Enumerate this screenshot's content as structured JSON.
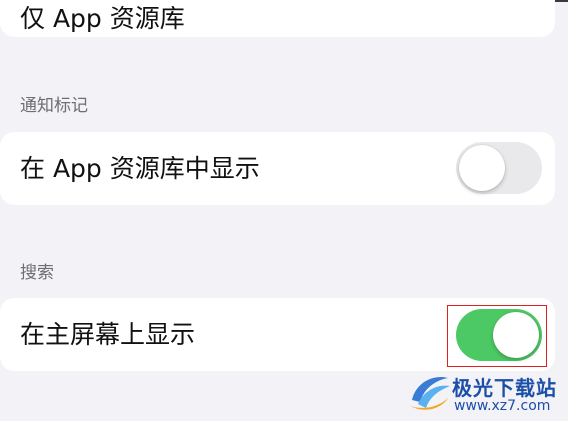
{
  "top_row": {
    "label": "仅 App 资源库"
  },
  "badge_section": {
    "header": "通知标记",
    "row_label": "在 App 资源库中显示",
    "toggle_on": false
  },
  "search_section": {
    "header": "搜索",
    "row_label": "在主屏幕上显示",
    "toggle_on": true
  },
  "colors": {
    "background": "#f2f2f7",
    "toggle_on": "#4cc964",
    "toggle_off": "#e9e9eb",
    "highlight": "#e02020"
  },
  "watermark": {
    "name": "极光下载站",
    "url": "www.xz7.com",
    "icon": "aurora-logo-icon"
  }
}
